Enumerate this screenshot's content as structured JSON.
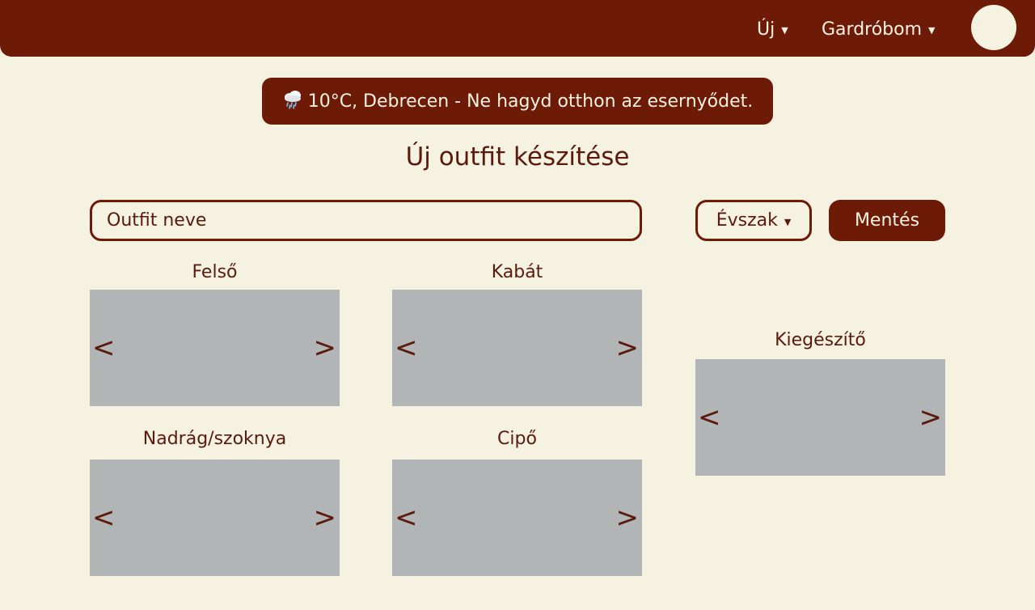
{
  "nav": {
    "new_label": "Új",
    "wardrobe_label": "Gardróbom"
  },
  "weather": {
    "icon": "rain-cloud-icon",
    "text": "10°C, Debrecen - Ne hagyd otthon az esernyődet."
  },
  "page": {
    "title": "Új outfit készítése"
  },
  "form": {
    "name_placeholder": "Outfit neve",
    "name_value": "",
    "season_label": "Évszak",
    "save_label": "Mentés"
  },
  "slots": {
    "top": "Felső",
    "coat": "Kabát",
    "bottom": "Nadrág/szoknya",
    "shoes": "Cipő",
    "accessory": "Kiegészítő"
  },
  "arrows": {
    "prev": "<",
    "next": ">"
  },
  "colors": {
    "brand": "#6d1a06",
    "background": "#f6f2e2",
    "text": "#5a1a0c",
    "slot_placeholder": "#b2b5b5"
  }
}
